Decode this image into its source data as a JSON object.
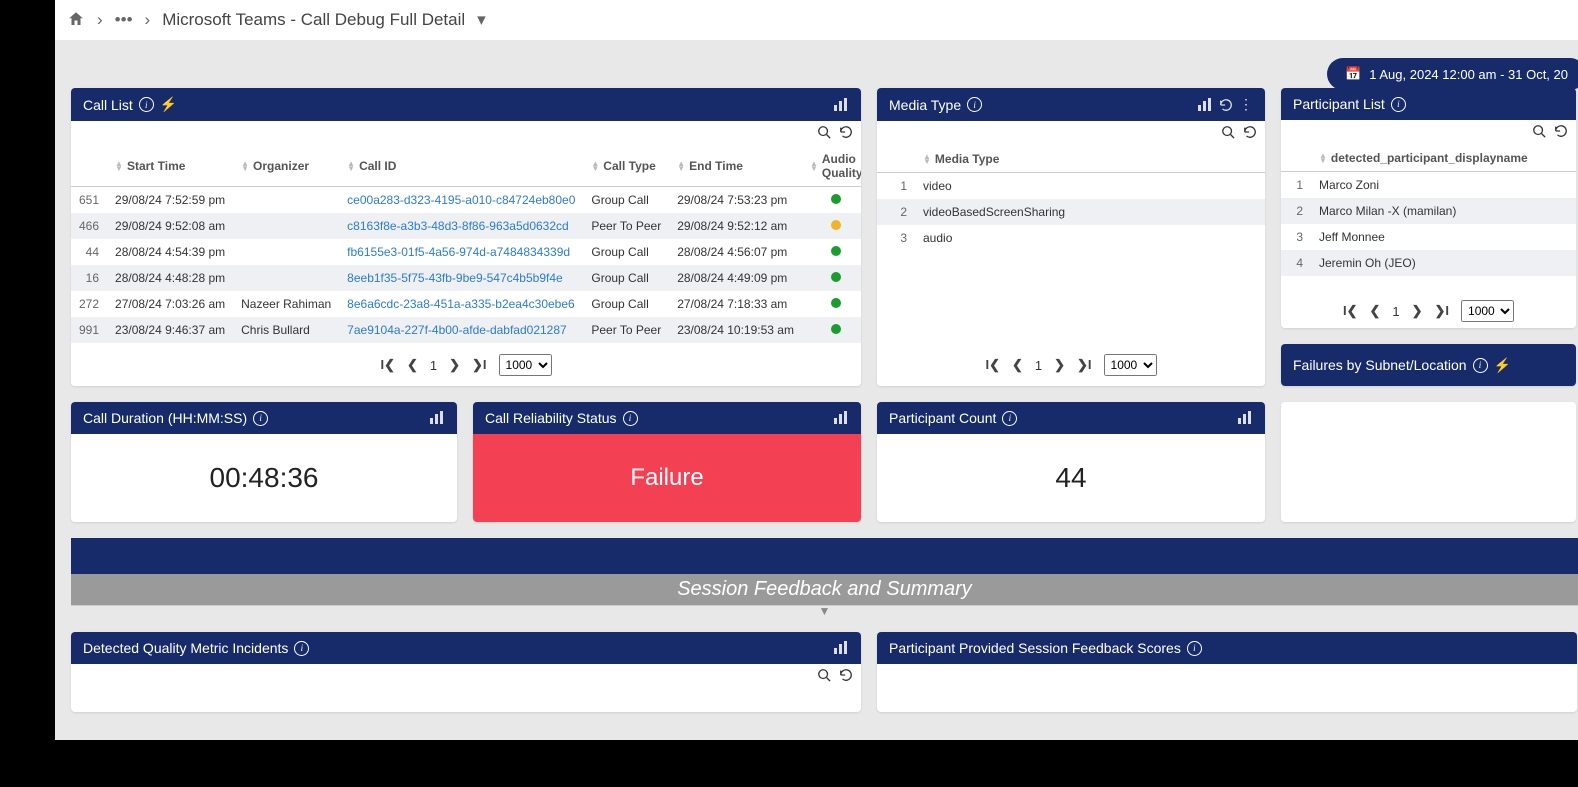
{
  "breadcrumb": {
    "title": "Microsoft Teams - Call Debug Full Detail",
    "dots": "•••"
  },
  "date_range": "1 Aug, 2024 12:00 am - 31 Oct, 20",
  "panels": {
    "call_list": {
      "title": "Call List",
      "cols": [
        "Start Time",
        "Organizer",
        "Call ID",
        "Call Type",
        "End Time",
        "Audio Quality"
      ],
      "rows": [
        {
          "idx": "651",
          "start": "29/08/24 7:52:59 pm",
          "org": "",
          "cid": "ce00a283-d323-4195-a010-c84724eb80e0",
          "type": "Group Call",
          "end": "29/08/24 7:53:23 pm",
          "q": "green"
        },
        {
          "idx": "466",
          "start": "29/08/24 9:52:08 am",
          "org": "",
          "cid": "c8163f8e-a3b3-48d3-8f86-963a5d0632cd",
          "type": "Peer To Peer",
          "end": "29/08/24 9:52:12 am",
          "q": "amber"
        },
        {
          "idx": "44",
          "start": "28/08/24 4:54:39 pm",
          "org": "",
          "cid": "fb6155e3-01f5-4a56-974d-a7484834339d",
          "type": "Group Call",
          "end": "28/08/24 4:56:07 pm",
          "q": "green"
        },
        {
          "idx": "16",
          "start": "28/08/24 4:48:28 pm",
          "org": "",
          "cid": "8eeb1f35-5f75-43fb-9be9-547c4b5b9f4e",
          "type": "Group Call",
          "end": "28/08/24 4:49:09 pm",
          "q": "green"
        },
        {
          "idx": "272",
          "start": "27/08/24 7:03:26 am",
          "org": "Nazeer Rahiman",
          "cid": "8e6a6cdc-23a8-451a-a335-b2ea4c30ebe6",
          "type": "Group Call",
          "end": "27/08/24 7:18:33 am",
          "q": "green"
        },
        {
          "idx": "991",
          "start": "23/08/24 9:46:37 am",
          "org": "Chris Bullard",
          "cid": "7ae9104a-227f-4b00-afde-dabfad021287",
          "type": "Peer To Peer",
          "end": "23/08/24 10:19:53 am",
          "q": "green"
        }
      ],
      "page_size": "1000",
      "page": "1"
    },
    "media_type": {
      "title": "Media Type",
      "col": "Media Type",
      "rows": [
        {
          "idx": "1",
          "v": "video"
        },
        {
          "idx": "2",
          "v": "videoBasedScreenSharing"
        },
        {
          "idx": "3",
          "v": "audio"
        }
      ],
      "page_size": "1000",
      "page": "1"
    },
    "participant_list": {
      "title": "Participant List",
      "col": "detected_participant_displayname",
      "rows": [
        {
          "idx": "1",
          "v": "Marco Zoni"
        },
        {
          "idx": "2",
          "v": "Marco Milan -X (mamilan)"
        },
        {
          "idx": "3",
          "v": "Jeff Monnee"
        },
        {
          "idx": "4",
          "v": "Jeremin Oh (JEO)"
        }
      ],
      "page_size": "1000",
      "page": "1"
    },
    "failures": {
      "title": "Failures by Subnet/Location"
    },
    "duration": {
      "title": "Call Duration (HH:MM:SS)",
      "value": "00:48:36"
    },
    "reliability": {
      "title": "Call Reliability Status",
      "value": "Failure"
    },
    "pcount": {
      "title": "Participant Count",
      "value": "44"
    },
    "session_bar": "Session Feedback and Summary",
    "quality_incidents": {
      "title": "Detected Quality Metric Incidents"
    },
    "feedback_scores": {
      "title": "Participant Provided Session Feedback Scores"
    }
  }
}
